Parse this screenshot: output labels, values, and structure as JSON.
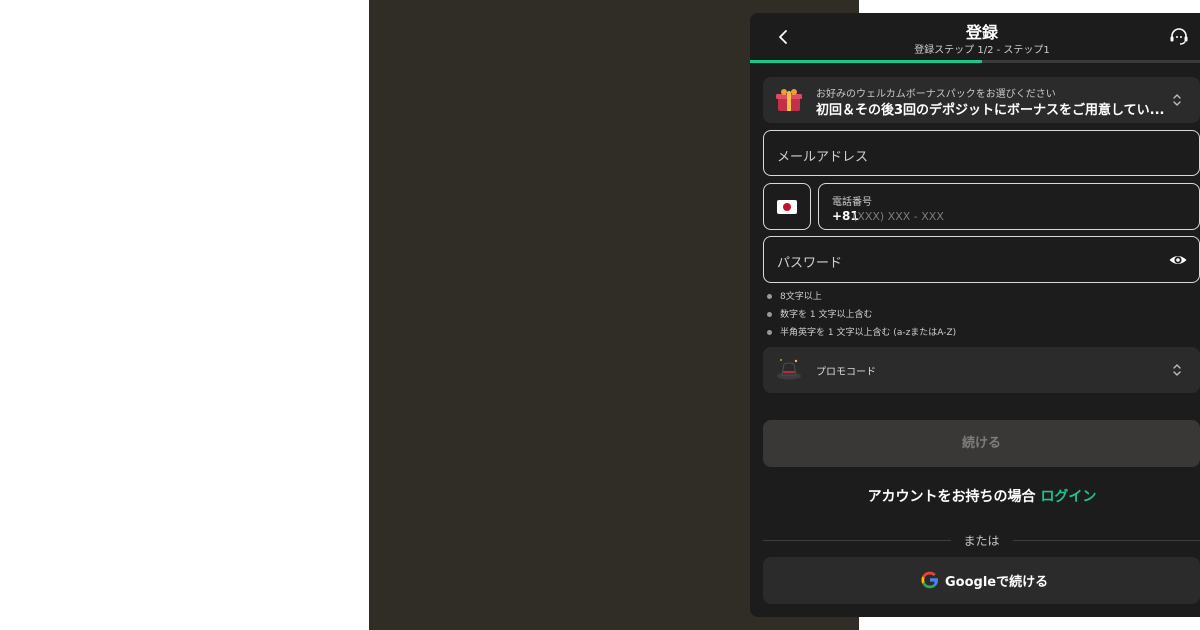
{
  "header": {
    "title": "登録",
    "subtitle": "登録ステップ 1/2 - ステップ1",
    "back_icon": "chevron-left-icon",
    "support_icon": "headset-support-icon",
    "progress": 0.5,
    "accent": "#1ec58a"
  },
  "bonus": {
    "caption": "お好みのウェルカムボーナスパックをお選びください",
    "value": "初回＆その後3回のデポジットにボーナスをご用意してい...",
    "icon": "gift-icon"
  },
  "form": {
    "email_label": "メールアドレス",
    "phone_label": "電話番号",
    "phone_code": "+81",
    "phone_placeholder": "(XXX) XXX - XXX",
    "flag_icon": "japan-flag-icon",
    "password_label": "パスワード",
    "password_icon": "eye-icon"
  },
  "password_rules": [
    "8文字以上",
    "数字を 1 文字以上含む",
    "半角英字を 1 文字以上含む (a-zまたはA-Z)"
  ],
  "promo": {
    "label": "プロモコード",
    "icon": "magic-hat-icon"
  },
  "continue_label": "続ける",
  "login": {
    "prompt": "アカウントをお持ちの場合 ",
    "link": "ログイン"
  },
  "divider_text": "または",
  "google_label": "Googleで続ける"
}
